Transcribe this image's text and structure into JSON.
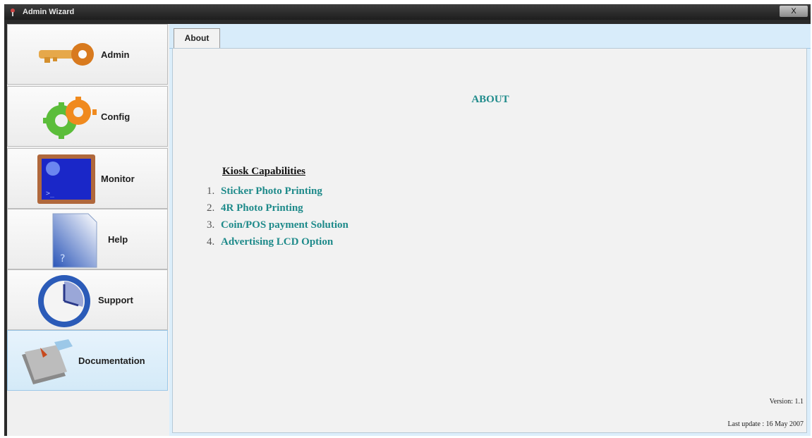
{
  "window": {
    "title": "Admin Wizard",
    "close_label": "X"
  },
  "sidebar": {
    "items": [
      {
        "label": "Admin",
        "icon": "key-icon"
      },
      {
        "label": "Config",
        "icon": "gears-icon"
      },
      {
        "label": "Monitor",
        "icon": "monitor-icon"
      },
      {
        "label": "Help",
        "icon": "help-book-icon"
      },
      {
        "label": "Support",
        "icon": "clock-icon"
      },
      {
        "label": "Documentation",
        "icon": "documents-icon"
      }
    ],
    "selected": "Documentation"
  },
  "tabs": [
    {
      "label": "About"
    }
  ],
  "about": {
    "title": "ABOUT",
    "capabilities_heading": "Kiosk Capabilities",
    "capabilities": [
      {
        "num": "1.",
        "text": "Sticker Photo Printing"
      },
      {
        "num": "2.",
        "text": "4R Photo Printing"
      },
      {
        "num": "3.",
        "text": "Coin/POS payment Solution"
      },
      {
        "num": "4.",
        "text": "Advertising LCD Option"
      }
    ],
    "version": "Version: 1.1",
    "last_update": "Last update : 16 May 2007"
  },
  "colors": {
    "accent_text": "#1e8a8a",
    "selected_nav": "#d4eaf8",
    "tab_strip": "#d8ecfa"
  }
}
